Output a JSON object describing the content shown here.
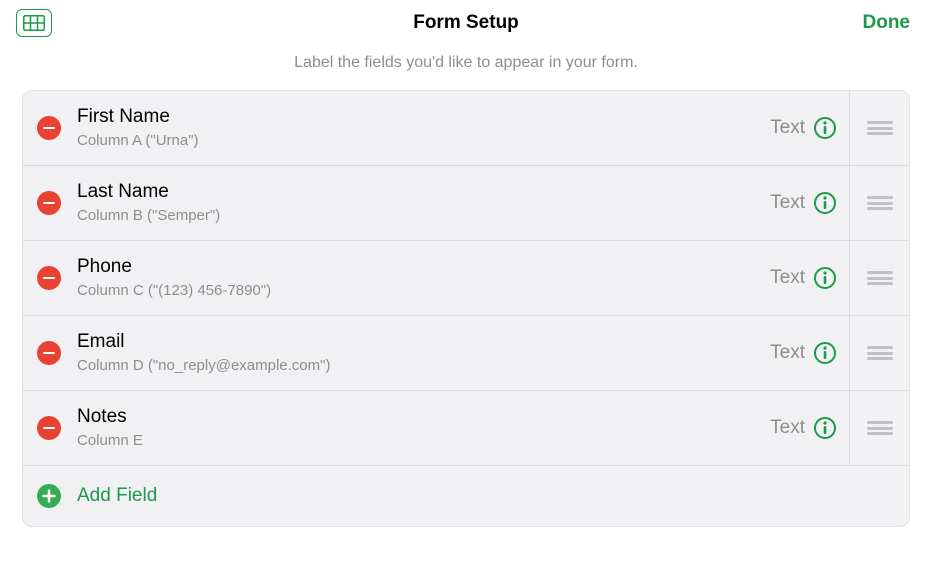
{
  "header": {
    "title": "Form Setup",
    "done_label": "Done"
  },
  "subtitle": "Label the fields you'd like to appear in your form.",
  "fields": [
    {
      "name": "First Name",
      "column": "Column A (\"Urna\")",
      "type": "Text"
    },
    {
      "name": "Last Name",
      "column": "Column B (\"Semper\")",
      "type": "Text"
    },
    {
      "name": "Phone",
      "column": "Column C (\"(123) 456-7890\")",
      "type": "Text"
    },
    {
      "name": "Email",
      "column": "Column D (\"no_reply@example.com\")",
      "type": "Text"
    },
    {
      "name": "Notes",
      "column": "Column E",
      "type": "Text"
    }
  ],
  "add_field_label": "Add Field"
}
